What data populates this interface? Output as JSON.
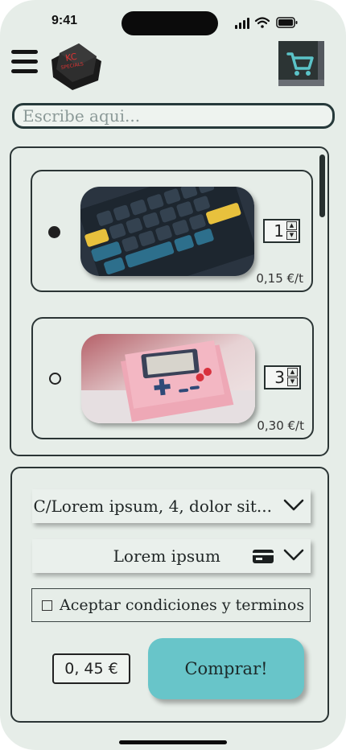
{
  "status_bar": {
    "time": "9:41"
  },
  "header": {
    "menu_icon": "hamburger-menu-icon",
    "logo_text": {
      "top": "KC",
      "bottom": "SPECIALS"
    },
    "cart_icon": "shopping-cart-icon"
  },
  "search": {
    "placeholder": "Escribe aqui...",
    "value": ""
  },
  "products": [
    {
      "selected": true,
      "image": "keyboard-keys-photo",
      "quantity": "1",
      "price": "0,15 €/t"
    },
    {
      "selected": false,
      "image": "gameboy-keycap-photo",
      "quantity": "3",
      "price": "0,30 €/t"
    }
  ],
  "checkout": {
    "address": "C/Lorem ipsum, 4, dolor sit...",
    "payment": "Lorem ipsum",
    "payment_icon": "credit-card-icon",
    "terms": "Aceptar condiciones y terminos",
    "total": "0, 45 €",
    "buy_label": "Comprar!"
  },
  "colors": {
    "background": "#e6ede8",
    "accent": "#68c5c9",
    "dark": "#2b3535"
  }
}
